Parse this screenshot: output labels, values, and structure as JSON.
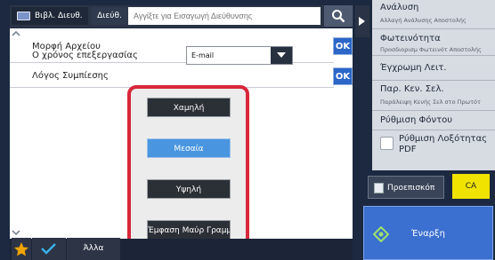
{
  "topbar": {
    "address_book_label": "Βιβλ. Διευθ.",
    "address_label": "Διεύθ.",
    "address_placeholder": "Αγγίξτε για Εισαγωγή Διεύθυνσης"
  },
  "panel": {
    "file_format_label": "Μορφή Αρχείου",
    "processing_time_label": "Ο χρόνος επεξεργασίας",
    "file_format_value": "E-mail",
    "compression_reason_label": "Λόγος Συμπίεσης",
    "ok_label": "OK",
    "compression_options": [
      {
        "label": "Χαμηλή",
        "selected": false
      },
      {
        "label": "Μεσαία",
        "selected": true
      },
      {
        "label": "Υψηλή",
        "selected": false
      },
      {
        "label": "Έμφαση Μαύρ Γραμμ",
        "selected": false
      }
    ]
  },
  "bottombar": {
    "other_label": "Άλλα"
  },
  "right_panel": {
    "items": [
      {
        "title": "Ανάλυση",
        "subtitle": "Αλλαγή Ανάλυσης Αποστολής"
      },
      {
        "title": "Φωτεινότητα",
        "subtitle": "Προσδιορισμ Φωτεινότ Αποστολής"
      },
      {
        "title": "Έγχρωμη Λειτ.",
        "subtitle": ""
      },
      {
        "title": "Παρ. Κεν. Σελ.",
        "subtitle": "Παράλειψη Κενής Σελ στο Πρωτότ"
      },
      {
        "title": "Ρύθμιση Φόντου",
        "subtitle": ""
      },
      {
        "title": "Ρύθμιση Λοξότητας PDF",
        "subtitle": ""
      }
    ],
    "preview_label": "Προεπισκόπ",
    "ca_label": "CA",
    "start_label": "Έναρξη"
  },
  "colors": {
    "accent": "#2b66c8",
    "selected_option": "#4a95e0",
    "highlight_border": "#d8283a",
    "ca_button": "#f0e300"
  }
}
